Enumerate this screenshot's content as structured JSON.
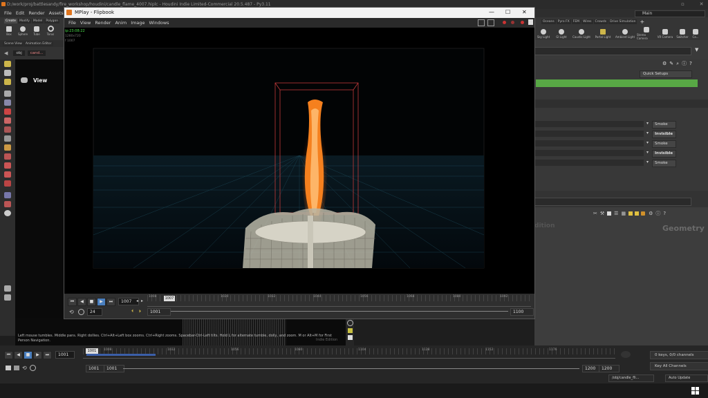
{
  "main_title": "D:/work/proj/battlesandy/fire_workshop/houdini/candle_flame_4007.hiplc - Houdini Indie Limited-Commercial 20.5.487 - Py3.11",
  "main_menu": [
    "File",
    "Edit",
    "Render",
    "Assets"
  ],
  "right_main_label": "Main",
  "shelf_tabs_left": [
    "Create",
    "Modify",
    "Model",
    "Polygon"
  ],
  "shelf_tools_left": [
    "Box",
    "Sphere",
    "Tube",
    "Torus"
  ],
  "shelf_tabs_right": [
    "Oceans",
    "Pyro FX",
    "FEM",
    "Wires",
    "Crowds",
    "Drive Simulation"
  ],
  "shelf_tools_right": [
    "Sky Light",
    "GI Light",
    "Caustic Light",
    "Portal Light",
    "Ambient Light",
    "Stereo Camera",
    "VR Camera",
    "Switcher",
    "Ca..."
  ],
  "pane_tabs_left": [
    "Scene View",
    "Animation Editor"
  ],
  "path_left": "obj",
  "path_left_2": "cand...",
  "view_label": "View",
  "flipbook": {
    "title": "MPlay - Flipbook",
    "menu": [
      "File",
      "View",
      "Render",
      "Anim",
      "Image",
      "Windows"
    ],
    "overlay_time": "ip:23:08:22",
    "overlay_res": "1280x720",
    "overlay_frame": "f 1007",
    "current_frame": "1007",
    "fps": "24",
    "range_start": "1001",
    "range_end": "1100",
    "ticks": [
      "1008",
      "1020",
      "1032",
      "1044",
      "1056",
      "1068",
      "1080",
      "1092"
    ],
    "playhead_label": "1007"
  },
  "right_panel": {
    "quick_setups": "Quick Setups",
    "params": [
      {
        "value": "Smoke"
      },
      {
        "value": "Invisible"
      },
      {
        "value": "Smoke"
      },
      {
        "value": "Invisible"
      },
      {
        "value": "Smoke"
      }
    ]
  },
  "network": {
    "label_left": "dition",
    "label_right": "Geometry"
  },
  "status_help": "Left mouse tumbles. Middle pans. Right dollies. Ctrl+Alt+Left box zooms. Ctrl+Right zooms. Spacebar-Ctrl-Left tilts. Hold L for alternate tumble, dolly, and zoom. M or Alt+M for First Person Navigation.",
  "scene_label": "Indie Edition",
  "timeline": {
    "frame": "1001",
    "playhead_label": "1001",
    "ticks": [
      "1008",
      "1032",
      "1056",
      "1080",
      "1104",
      "1128",
      "1152",
      "1176"
    ],
    "start": "1001",
    "start2": "1001",
    "end": "1200",
    "end2": "1200",
    "keys_channels": "0 keys, 0/0 channels",
    "key_all": "Key All Channels"
  },
  "statusbar": {
    "path": "/obj/candle_fli...",
    "auto_update": "Auto Update"
  },
  "colors": {
    "param_green": "#58a845",
    "timeline_blue": "#3b5fa8",
    "flame_orange": "#f5801e",
    "bbox_red": "#c23a3a"
  }
}
